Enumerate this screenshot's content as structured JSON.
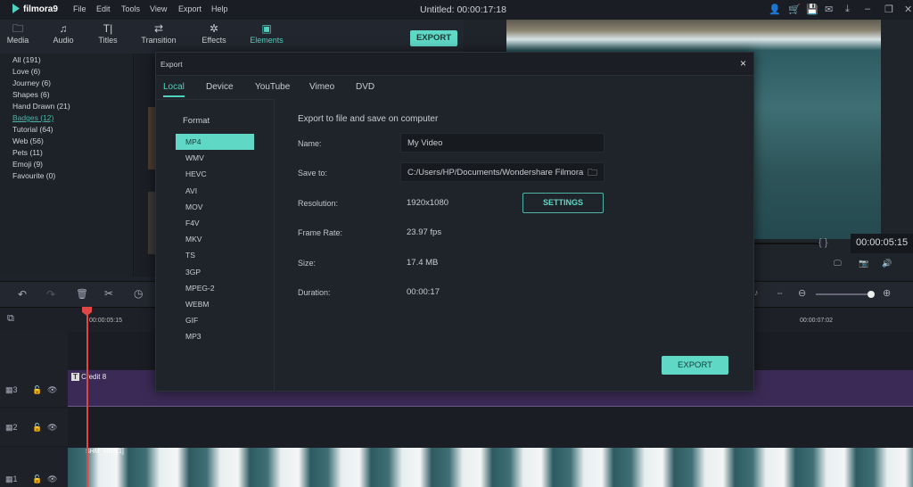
{
  "app": {
    "logo": "filmora9",
    "menu": [
      "File",
      "Edit",
      "Tools",
      "View",
      "Export",
      "Help"
    ],
    "title": "Untitled:",
    "timecode": "00:00:17:18"
  },
  "toolbar": {
    "tabs": [
      {
        "label": "Media",
        "icon": "folder"
      },
      {
        "label": "Audio",
        "icon": "music-note"
      },
      {
        "label": "Titles",
        "icon": "text-T"
      },
      {
        "label": "Transition",
        "icon": "transition"
      },
      {
        "label": "Effects",
        "icon": "effects"
      },
      {
        "label": "Elements",
        "icon": "image"
      }
    ],
    "active": "Elements",
    "export_label": "EXPORT"
  },
  "categories": [
    "All (191)",
    "Love (6)",
    "Journey (6)",
    "Shapes (6)",
    "Hand Drawn (21)",
    "Badges (12)",
    "Tutorial (64)",
    "Web (56)",
    "Pets (11)",
    "Emoji (9)",
    "Favourite (0)"
  ],
  "active_category": "Badges (12)",
  "preview": {
    "timecode": "00:00:05:15",
    "brackets": "{ }"
  },
  "timeline": {
    "ruler": [
      "00:00:05:15",
      "00:00:07:02"
    ],
    "tracks": [
      {
        "num": "3",
        "clip": "Credit 8"
      },
      {
        "num": "2"
      },
      {
        "num": "1",
        "clip": "SHM_4818[1]"
      }
    ]
  },
  "dialog": {
    "title": "Export",
    "tabs": [
      "Local",
      "Device",
      "YouTube",
      "Vimeo",
      "DVD"
    ],
    "active_tab": "Local",
    "format_heading": "Format",
    "formats": [
      "MP4",
      "WMV",
      "HEVC",
      "AVI",
      "MOV",
      "F4V",
      "MKV",
      "TS",
      "3GP",
      "MPEG-2",
      "WEBM",
      "GIF",
      "MP3"
    ],
    "selected_format": "MP4",
    "heading": "Export to file and save on computer",
    "name_label": "Name:",
    "name_value": "My Video",
    "save_label": "Save to:",
    "save_value": "C:/Users/HP/Documents/Wondershare Filmora",
    "resolution_label": "Resolution:",
    "resolution_value": "1920x1080",
    "settings_label": "SETTINGS",
    "framerate_label": "Frame Rate:",
    "framerate_value": "23.97 fps",
    "size_label": "Size:",
    "size_value": "17.4 MB",
    "duration_label": "Duration:",
    "duration_value": "00:00:17",
    "export_label": "EXPORT",
    "close": "×"
  },
  "colors": {
    "accent": "#5fd8c6",
    "playhead": "#e04848",
    "title_clip": "#3b2a55"
  }
}
